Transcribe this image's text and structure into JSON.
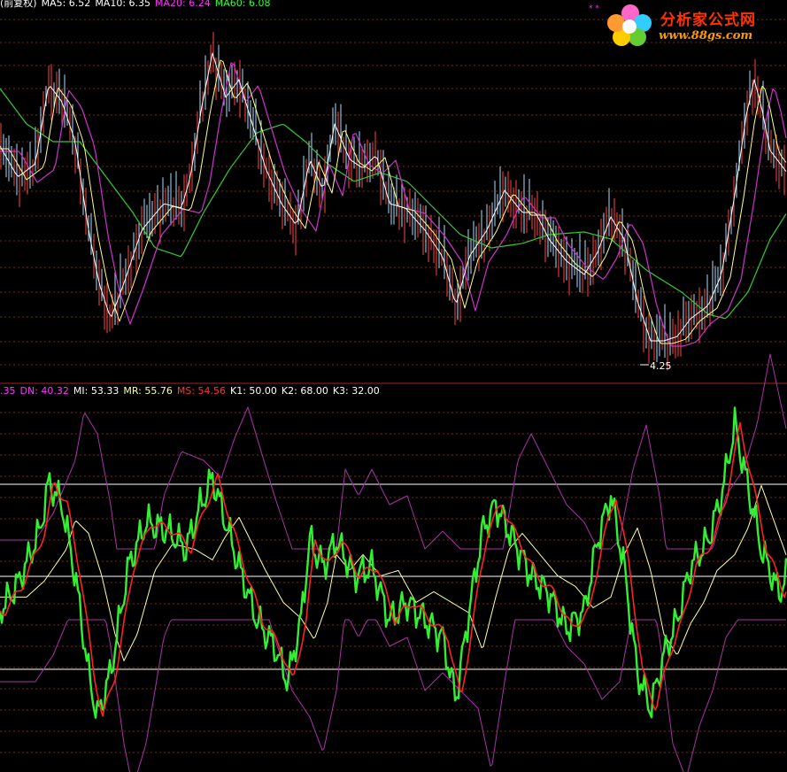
{
  "top_panel": {
    "legend": [
      {
        "text": "(前复权)",
        "color": "#ffffff"
      },
      {
        "text": "MA5: 6.52",
        "color": "#ffffff"
      },
      {
        "text": "MA10: 6.35",
        "color": "#ffffff"
      },
      {
        "text": "MA20: 6.24",
        "color": "#ff33ff"
      },
      {
        "text": "MA60: 6.08",
        "color": "#33ff33"
      }
    ],
    "low_marker": "4.25"
  },
  "bottom_panel": {
    "legend": [
      {
        "text": ".35",
        "color": "#ff33ff"
      },
      {
        "text": "DN: 40.32",
        "color": "#ff33ff"
      },
      {
        "text": "MI: 53.33",
        "color": "#ffffff"
      },
      {
        "text": "MR: 55.76",
        "color": "#ffff99"
      },
      {
        "text": "MS: 54.56",
        "color": "#ff3333"
      },
      {
        "text": "K1: 50.00",
        "color": "#ffffff"
      },
      {
        "text": "K2: 68.00",
        "color": "#ffffff"
      },
      {
        "text": "K3: 32.00",
        "color": "#ffffff"
      }
    ]
  },
  "watermark": {
    "brand_cn": "分析家公式网",
    "brand_url": "www.88gs.com",
    "stars": "* *"
  },
  "colors": {
    "background": "#000000",
    "grid": "#7a2e00",
    "ma5": "#ffffff",
    "ma10": "#ffff88",
    "ma20": "#cc33cc",
    "ma60": "#33cc33",
    "candle_up": "#ff4444",
    "candle_down": "#aaddff",
    "osc_main": "#33ee33",
    "osc_signal": "#ff2222",
    "osc_mid": "#ffffaa",
    "band": "#aa33aa",
    "level_lines": "#ffffff"
  }
}
